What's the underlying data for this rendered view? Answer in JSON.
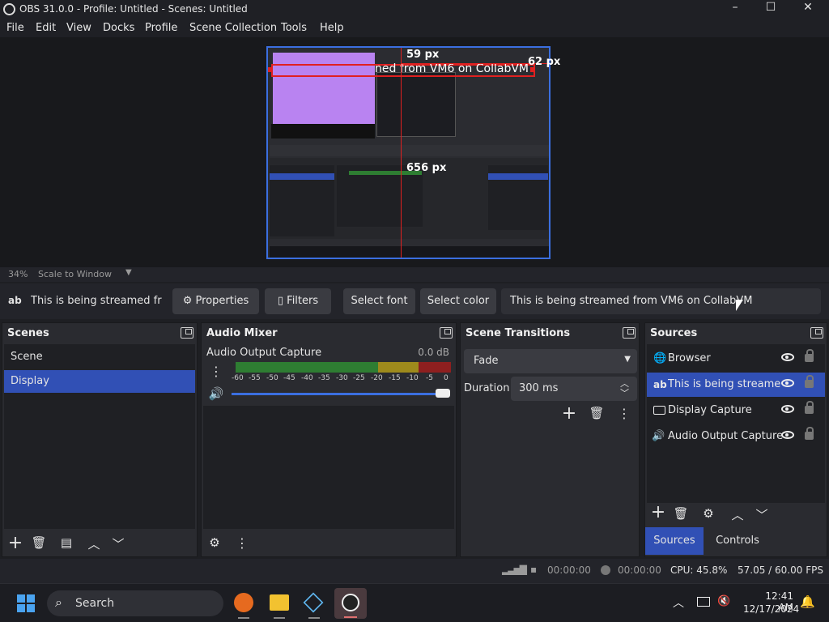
{
  "window": {
    "title": "OBS 31.0.0 - Profile: Untitled - Scenes: Untitled",
    "minimize": "–",
    "maximize": "☐",
    "close": "✕"
  },
  "menu": [
    "File",
    "Edit",
    "View",
    "Docks",
    "Profile",
    "Scene Collection",
    "Tools",
    "Help"
  ],
  "preview": {
    "ruler_top": "59 px",
    "ruler_right": "62 px",
    "ruler_bottom": "656 px",
    "text_source_overlay": "ned from VM6 on CollabVM",
    "zoom": "34%",
    "scale_mode": "Scale to Window"
  },
  "source_toolbar": {
    "source_icon": "ab",
    "source_name": "This is being streamed from",
    "properties": "Properties",
    "filters": "Filters",
    "select_font": "Select font",
    "select_color": "Select color",
    "text_value": "This is being streamed from VM6 on CollabVM"
  },
  "scenes": {
    "title": "Scenes",
    "items": [
      "Scene",
      "Display"
    ],
    "selected": 1
  },
  "audio_mixer": {
    "title": "Audio Mixer",
    "channel": "Audio Output Capture",
    "level": "0.0 dB",
    "ticks": [
      "-60",
      "-55",
      "-50",
      "-45",
      "-40",
      "-35",
      "-30",
      "-25",
      "-20",
      "-15",
      "-10",
      "-5",
      "0"
    ],
    "volume": 1.0
  },
  "scene_transitions": {
    "title": "Scene Transitions",
    "transition": "Fade",
    "duration_label": "Duration",
    "duration_value": "300 ms"
  },
  "sources": {
    "title": "Sources",
    "items": [
      {
        "name": "Browser",
        "icon": "globe-icon"
      },
      {
        "name": "This is being streamed f",
        "icon": "text-icon",
        "icon_text": "ab"
      },
      {
        "name": "Display Capture",
        "icon": "monitor-icon"
      },
      {
        "name": "Audio Output Capture",
        "icon": "speaker-icon"
      }
    ],
    "selected": 1,
    "tabs": [
      "Sources",
      "Controls"
    ]
  },
  "status": {
    "rec_time": "00:00:00",
    "stream_time": "00:00:00",
    "cpu": "CPU: 45.8%",
    "fps": "57.05 / 60.00 FPS"
  },
  "taskbar": {
    "search_placeholder": "Search",
    "time": "12:41 AM",
    "date": "12/17/2024"
  },
  "colors": {
    "accent": "#3150b5",
    "selection_red": "#e02020",
    "meter_green": "#2e7d32",
    "meter_yellow": "#9e8a1c",
    "meter_red": "#8e1f1f"
  }
}
